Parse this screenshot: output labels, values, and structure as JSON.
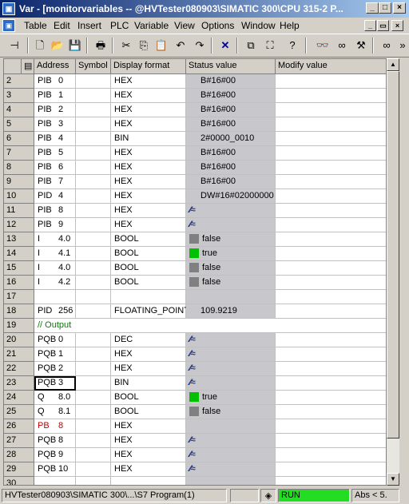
{
  "window": {
    "title": "Var - [monitorvariables -- @HVTester080903\\SIMATIC 300\\CPU 315-2 P..."
  },
  "menu": [
    "Table",
    "Edit",
    "Insert",
    "PLC",
    "Variable",
    "View",
    "Options",
    "Window",
    "Help"
  ],
  "columns": [
    "Address",
    "Symbol",
    "Display format",
    "Status value",
    "Modify value"
  ],
  "rows": [
    {
      "n": "2",
      "a": "PIB",
      "i": "0",
      "f": "HEX",
      "s": "B#16#00"
    },
    {
      "n": "3",
      "a": "PIB",
      "i": "1",
      "f": "HEX",
      "s": "B#16#00"
    },
    {
      "n": "4",
      "a": "PIB",
      "i": "2",
      "f": "HEX",
      "s": "B#16#00"
    },
    {
      "n": "5",
      "a": "PIB",
      "i": "3",
      "f": "HEX",
      "s": "B#16#00"
    },
    {
      "n": "6",
      "a": "PIB",
      "i": "4",
      "f": "BIN",
      "s": "2#0000_0010"
    },
    {
      "n": "7",
      "a": "PIB",
      "i": "5",
      "f": "HEX",
      "s": "B#16#00"
    },
    {
      "n": "8",
      "a": "PIB",
      "i": "6",
      "f": "HEX",
      "s": "B#16#00"
    },
    {
      "n": "9",
      "a": "PIB",
      "i": "7",
      "f": "HEX",
      "s": "B#16#00"
    },
    {
      "n": "10",
      "a": "PID",
      "i": "4",
      "f": "HEX",
      "s": "DW#16#02000000"
    },
    {
      "n": "11",
      "a": "PIB",
      "i": "8",
      "f": "HEX",
      "s": "",
      "nv": true
    },
    {
      "n": "12",
      "a": "PIB",
      "i": "9",
      "f": "HEX",
      "s": "",
      "nv": true
    },
    {
      "n": "13",
      "a": "I",
      "i": "4.0",
      "f": "BOOL",
      "s": "false",
      "box": "#808080"
    },
    {
      "n": "14",
      "a": "I",
      "i": "4.1",
      "f": "BOOL",
      "s": "true",
      "box": "#00c000"
    },
    {
      "n": "15",
      "a": "I",
      "i": "4.0",
      "f": "BOOL",
      "s": "false",
      "box": "#808080"
    },
    {
      "n": "16",
      "a": "I",
      "i": "4.2",
      "f": "BOOL",
      "s": "false",
      "box": "#808080"
    },
    {
      "n": "17",
      "a": "",
      "i": "",
      "f": "",
      "s": ""
    },
    {
      "n": "18",
      "a": "PID",
      "i": "256",
      "f": "FLOATING_POINT",
      "s": "109.9219"
    },
    {
      "n": "19",
      "comment": "// Output"
    },
    {
      "n": "20",
      "a": "PQB",
      "i": "0",
      "f": "DEC",
      "s": "",
      "nv": true
    },
    {
      "n": "21",
      "a": "PQB",
      "i": "1",
      "f": "HEX",
      "s": "",
      "nv": true
    },
    {
      "n": "22",
      "a": "PQB",
      "i": "2",
      "f": "HEX",
      "s": "",
      "nv": true
    },
    {
      "n": "23",
      "a": "PQB",
      "i": "3",
      "f": "BIN",
      "s": "",
      "nv": true,
      "sel": true
    },
    {
      "n": "24",
      "a": "Q",
      "i": "8.0",
      "f": "BOOL",
      "s": "true",
      "box": "#00c000"
    },
    {
      "n": "25",
      "a": "Q",
      "i": "8.1",
      "f": "BOOL",
      "s": "false",
      "box": "#808080"
    },
    {
      "n": "26",
      "a": "PB",
      "i": "8",
      "f": "HEX",
      "s": "",
      "red": true
    },
    {
      "n": "27",
      "a": "PQB",
      "i": "8",
      "f": "HEX",
      "s": "",
      "nv": true
    },
    {
      "n": "28",
      "a": "PQB",
      "i": "9",
      "f": "HEX",
      "s": "",
      "nv": true
    },
    {
      "n": "29",
      "a": "PQB",
      "i": "10",
      "f": "HEX",
      "s": "",
      "nv": true
    },
    {
      "n": "30",
      "a": "",
      "i": "",
      "f": "",
      "s": ""
    }
  ],
  "status": {
    "path": "HVTester080903\\SIMATIC 300\\...\\S7 Program(1)",
    "mode": "RUN",
    "abs": "Abs < 5."
  }
}
